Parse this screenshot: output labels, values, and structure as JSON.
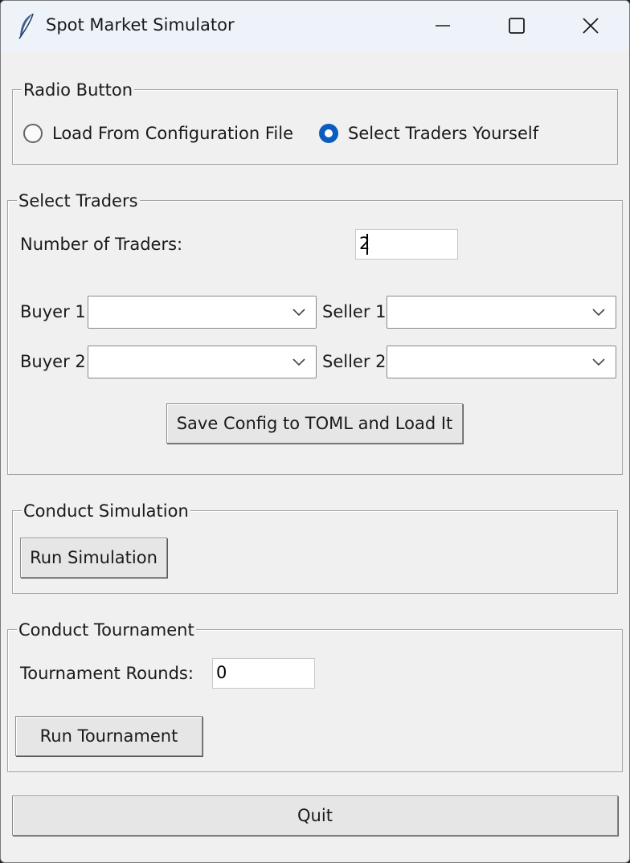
{
  "window": {
    "title": "Spot Market Simulator",
    "icon": "feather-icon",
    "controls": [
      "minimize-icon",
      "maximize-icon",
      "close-icon"
    ]
  },
  "radio_group": {
    "label": "Radio Button",
    "options": [
      {
        "label": "Load From Configuration File",
        "selected": false
      },
      {
        "label": "Select Traders Yourself",
        "selected": true
      }
    ],
    "accent_color": "#0b5cbe"
  },
  "select_traders": {
    "label": "Select Traders",
    "number_label": "Number of Traders:",
    "number_value": "2",
    "rows": [
      {
        "buyer_label": "Buyer 1",
        "buyer_value": "",
        "seller_label": "Seller 1",
        "seller_value": ""
      },
      {
        "buyer_label": "Buyer 2",
        "buyer_value": "",
        "seller_label": "Seller 2",
        "seller_value": ""
      }
    ],
    "save_button": "Save Config to TOML and Load It"
  },
  "simulation": {
    "label": "Conduct Simulation",
    "run_button": "Run Simulation"
  },
  "tournament": {
    "label": "Conduct Tournament",
    "rounds_label": "Tournament Rounds:",
    "rounds_value": "0",
    "run_button": "Run Tournament"
  },
  "quit_button": "Quit"
}
